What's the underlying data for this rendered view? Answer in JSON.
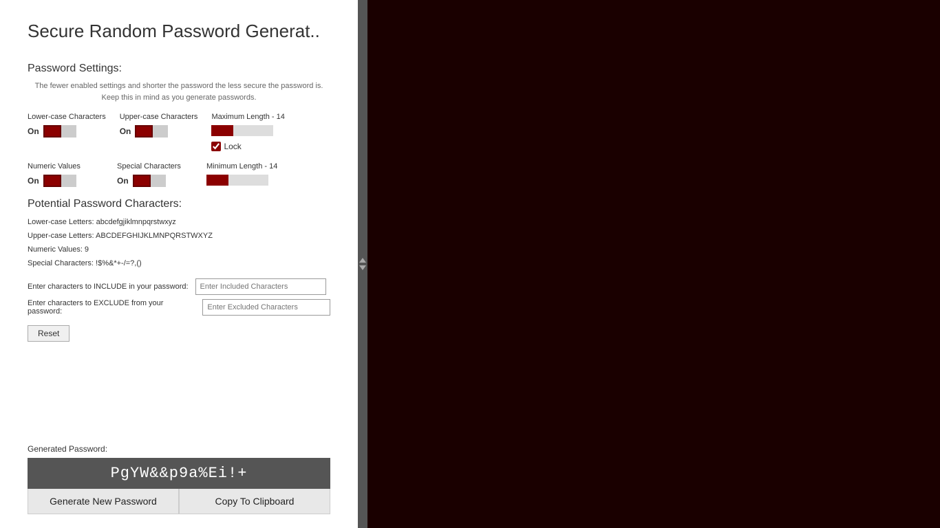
{
  "app": {
    "title": "Secure Random Password Generat.."
  },
  "left_panel": {
    "password_settings": {
      "header": "Password Settings:",
      "info_line1": "The fewer enabled settings and shorter the password the less secure the password is.",
      "info_line2": "Keep this in mind as you generate passwords.",
      "lower_case": {
        "label": "Lower-case Characters",
        "status": "On"
      },
      "upper_case": {
        "label": "Upper-case Characters",
        "status": "On"
      },
      "max_length": {
        "label": "Maximum Length - 14",
        "lock_label": "Lock"
      },
      "numeric": {
        "label": "Numeric Values",
        "status": "On"
      },
      "special": {
        "label": "Special Characters",
        "status": "On"
      },
      "min_length": {
        "label": "Minimum Length - 14"
      }
    },
    "potential_chars": {
      "header": "Potential Password Characters:",
      "lowercase_line": "Lower-case Letters: abcdefgjiklmnpqrstwxyz",
      "uppercase_line": "Upper-case Letters: ABCDEFGHIJKLMNPQRSTWXYZ",
      "numeric_line": "Numeric Values: 9",
      "special_line": "Special Characters: !$%&*+-/=?,()",
      "include_label": "Enter characters to INCLUDE in your password:",
      "exclude_label": "Enter characters to EXCLUDE from your password:",
      "include_placeholder": "Enter Included Characters",
      "exclude_placeholder": "Enter Excluded Characters",
      "reset_label": "Reset"
    },
    "generated": {
      "label": "Generated Password:",
      "password": "PgYW&&p9a%Ei!+",
      "generate_btn": "Generate New Password",
      "copy_btn": "Copy To Clipboard"
    }
  }
}
